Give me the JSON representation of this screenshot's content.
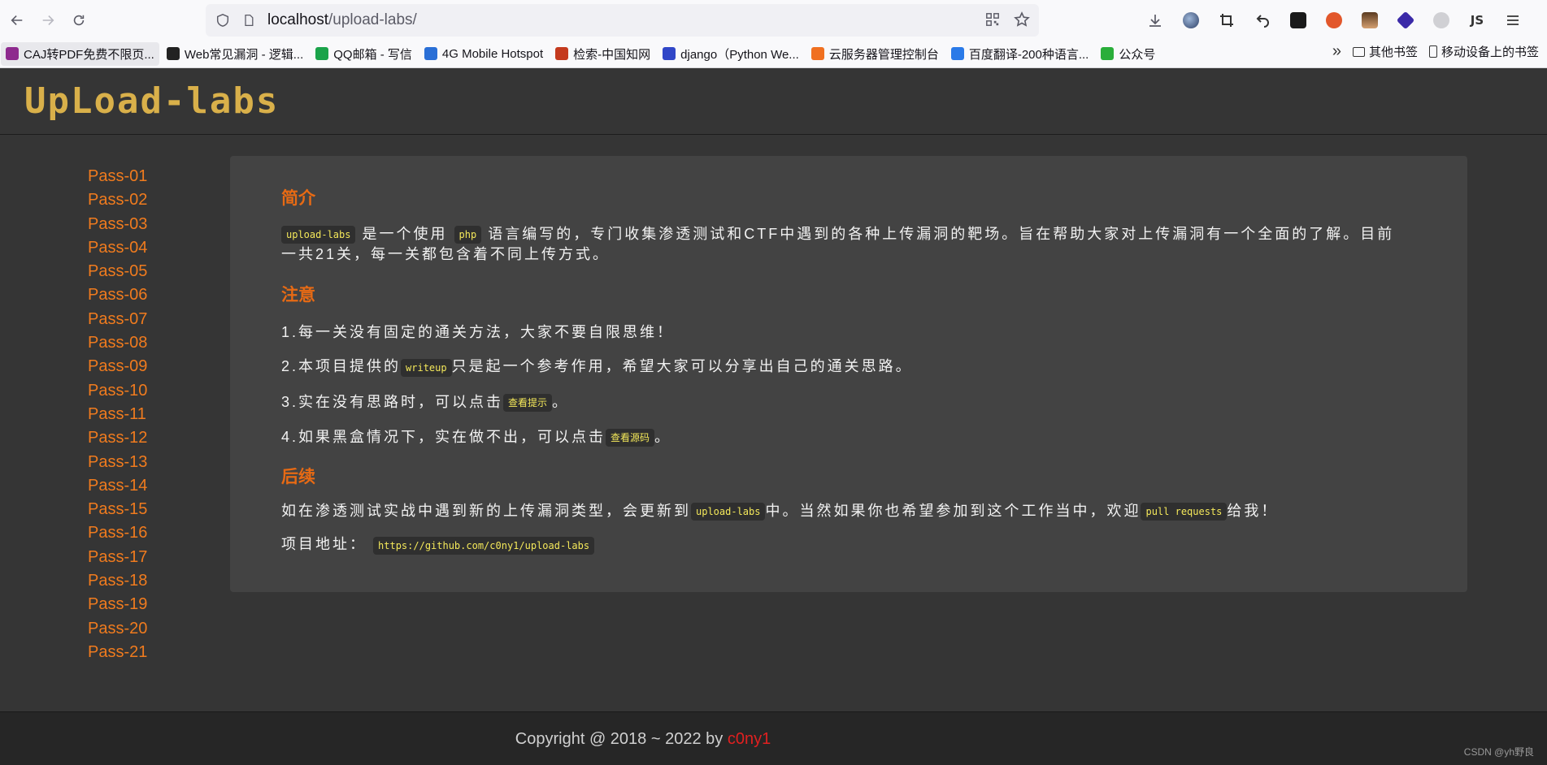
{
  "browser": {
    "url_host": "localhost",
    "url_path": "/upload-labs/"
  },
  "bookmarks": [
    {
      "label": "CAJ转PDF免费不限页...",
      "color": "#8e2a8e"
    },
    {
      "label": "Web常见漏洞 - 逻辑...",
      "color": "#222222"
    },
    {
      "label": "QQ邮箱 - 写信",
      "color": "#1aa34a"
    },
    {
      "label": "4G Mobile Hotspot",
      "color": "#2a6fd6"
    },
    {
      "label": "检索-中国知网",
      "color": "#c43a1e"
    },
    {
      "label": "django（Python We...",
      "color": "#3046c8"
    },
    {
      "label": "云服务器管理控制台",
      "color": "#f07020"
    },
    {
      "label": "百度翻译-200种语言...",
      "color": "#2a7ae8"
    },
    {
      "label": "公众号",
      "color": "#2aae3a"
    }
  ],
  "bookmarks_right": {
    "other": "其他书签",
    "mobile": "移动设备上的书签"
  },
  "site": {
    "logo": "UpLoad-labs"
  },
  "sidebar": [
    "Pass-01",
    "Pass-02",
    "Pass-03",
    "Pass-04",
    "Pass-05",
    "Pass-06",
    "Pass-07",
    "Pass-08",
    "Pass-09",
    "Pass-10",
    "Pass-11",
    "Pass-12",
    "Pass-13",
    "Pass-14",
    "Pass-15",
    "Pass-16",
    "Pass-17",
    "Pass-18",
    "Pass-19",
    "Pass-20",
    "Pass-21"
  ],
  "content": {
    "intro_title": "简介",
    "intro_code1": "upload-labs",
    "intro_text1": "是一个使用",
    "intro_code2": "php",
    "intro_text2": "语言编写的，专门收集渗透测试和CTF中遇到的各种上传漏洞的靶场。旨在帮助大家对上传漏洞有一个全面的了解。目前一共21关，每一关都包含着不同上传方式。",
    "notice_title": "注意",
    "notice1": "1.每一关没有固定的通关方法，大家不要自限思维！",
    "notice2_pre": "2.本项目提供的",
    "notice2_code": "writeup",
    "notice2_post": "只是起一个参考作用，希望大家可以分享出自己的通关思路。",
    "notice3_pre": "3.实在没有思路时，可以点击",
    "notice3_code": "查看提示",
    "notice3_post": "。",
    "notice4_pre": "4.如果黑盒情况下，实在做不出，可以点击",
    "notice4_code": "查看源码",
    "notice4_post": "。",
    "follow_title": "后续",
    "follow_pre": "如在渗透测试实战中遇到新的上传漏洞类型，会更新到",
    "follow_code1": "upload-labs",
    "follow_mid": "中。当然如果你也希望参加到这个工作当中，欢迎",
    "follow_code2": "pull requests",
    "follow_post": "给我！",
    "addr_label": "项目地址：",
    "addr_code": "https://github.com/c0ny1/upload-labs"
  },
  "footer": {
    "copyright": "Copyright @ 2018 ~ 2022 by ",
    "author": "c0ny1",
    "watermark": "CSDN @yh野良"
  }
}
